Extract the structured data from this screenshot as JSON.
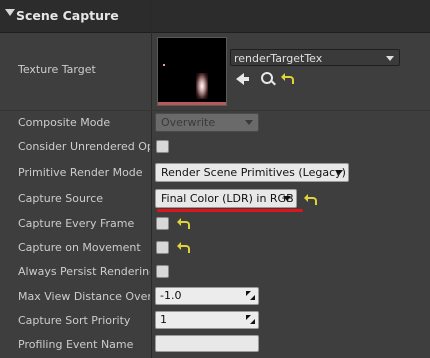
{
  "section": {
    "title": "Scene Capture"
  },
  "texture_target": {
    "label": "Texture Target",
    "asset_name": "renderTargetTex"
  },
  "composite_mode": {
    "label": "Composite Mode",
    "value": "Overwrite"
  },
  "consider_unrendered": {
    "label": "Consider Unrendered Opaq",
    "checked": false
  },
  "primitive_render_mode": {
    "label": "Primitive Render Mode",
    "value": "Render Scene Primitives (Legacy)"
  },
  "capture_source": {
    "label": "Capture Source",
    "value": "Final Color (LDR) in RGB"
  },
  "capture_every_frame": {
    "label": "Capture Every Frame",
    "checked": false
  },
  "capture_on_movement": {
    "label": "Capture on Movement",
    "checked": false
  },
  "always_persist": {
    "label": "Always Persist Rendering S",
    "checked": false
  },
  "max_view_distance": {
    "label": "Max View Distance Overric",
    "value": "-1.0"
  },
  "capture_sort_priority": {
    "label": "Capture Sort Priority",
    "value": "1"
  },
  "profiling_event_name": {
    "label": "Profiling Event Name",
    "value": ""
  },
  "colors": {
    "highlight": "#e0141a",
    "reset_arrow": "#e0d23a"
  }
}
